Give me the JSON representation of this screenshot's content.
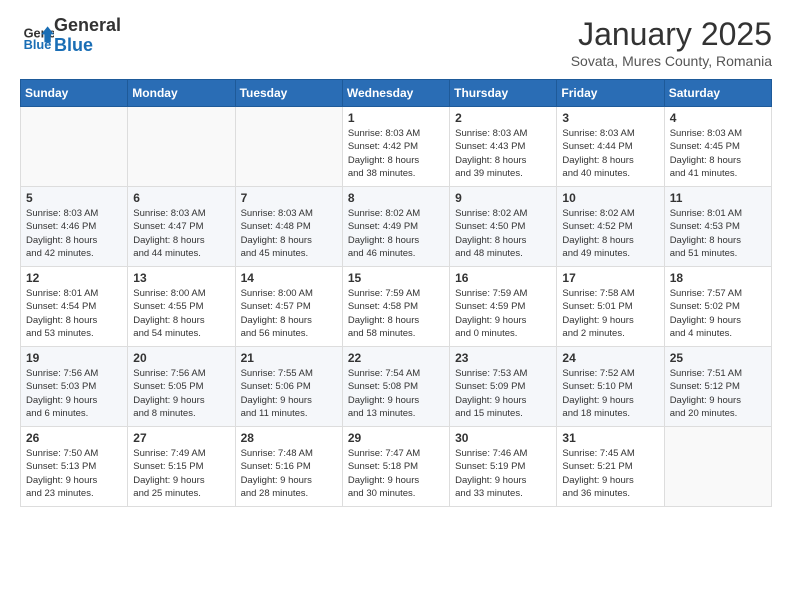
{
  "header": {
    "logo_general": "General",
    "logo_blue": "Blue",
    "month_title": "January 2025",
    "location": "Sovata, Mures County, Romania"
  },
  "days_of_week": [
    "Sunday",
    "Monday",
    "Tuesday",
    "Wednesday",
    "Thursday",
    "Friday",
    "Saturday"
  ],
  "weeks": [
    [
      {
        "day": "",
        "info": ""
      },
      {
        "day": "",
        "info": ""
      },
      {
        "day": "",
        "info": ""
      },
      {
        "day": "1",
        "info": "Sunrise: 8:03 AM\nSunset: 4:42 PM\nDaylight: 8 hours\nand 38 minutes."
      },
      {
        "day": "2",
        "info": "Sunrise: 8:03 AM\nSunset: 4:43 PM\nDaylight: 8 hours\nand 39 minutes."
      },
      {
        "day": "3",
        "info": "Sunrise: 8:03 AM\nSunset: 4:44 PM\nDaylight: 8 hours\nand 40 minutes."
      },
      {
        "day": "4",
        "info": "Sunrise: 8:03 AM\nSunset: 4:45 PM\nDaylight: 8 hours\nand 41 minutes."
      }
    ],
    [
      {
        "day": "5",
        "info": "Sunrise: 8:03 AM\nSunset: 4:46 PM\nDaylight: 8 hours\nand 42 minutes."
      },
      {
        "day": "6",
        "info": "Sunrise: 8:03 AM\nSunset: 4:47 PM\nDaylight: 8 hours\nand 44 minutes."
      },
      {
        "day": "7",
        "info": "Sunrise: 8:03 AM\nSunset: 4:48 PM\nDaylight: 8 hours\nand 45 minutes."
      },
      {
        "day": "8",
        "info": "Sunrise: 8:02 AM\nSunset: 4:49 PM\nDaylight: 8 hours\nand 46 minutes."
      },
      {
        "day": "9",
        "info": "Sunrise: 8:02 AM\nSunset: 4:50 PM\nDaylight: 8 hours\nand 48 minutes."
      },
      {
        "day": "10",
        "info": "Sunrise: 8:02 AM\nSunset: 4:52 PM\nDaylight: 8 hours\nand 49 minutes."
      },
      {
        "day": "11",
        "info": "Sunrise: 8:01 AM\nSunset: 4:53 PM\nDaylight: 8 hours\nand 51 minutes."
      }
    ],
    [
      {
        "day": "12",
        "info": "Sunrise: 8:01 AM\nSunset: 4:54 PM\nDaylight: 8 hours\nand 53 minutes."
      },
      {
        "day": "13",
        "info": "Sunrise: 8:00 AM\nSunset: 4:55 PM\nDaylight: 8 hours\nand 54 minutes."
      },
      {
        "day": "14",
        "info": "Sunrise: 8:00 AM\nSunset: 4:57 PM\nDaylight: 8 hours\nand 56 minutes."
      },
      {
        "day": "15",
        "info": "Sunrise: 7:59 AM\nSunset: 4:58 PM\nDaylight: 8 hours\nand 58 minutes."
      },
      {
        "day": "16",
        "info": "Sunrise: 7:59 AM\nSunset: 4:59 PM\nDaylight: 9 hours\nand 0 minutes."
      },
      {
        "day": "17",
        "info": "Sunrise: 7:58 AM\nSunset: 5:01 PM\nDaylight: 9 hours\nand 2 minutes."
      },
      {
        "day": "18",
        "info": "Sunrise: 7:57 AM\nSunset: 5:02 PM\nDaylight: 9 hours\nand 4 minutes."
      }
    ],
    [
      {
        "day": "19",
        "info": "Sunrise: 7:56 AM\nSunset: 5:03 PM\nDaylight: 9 hours\nand 6 minutes."
      },
      {
        "day": "20",
        "info": "Sunrise: 7:56 AM\nSunset: 5:05 PM\nDaylight: 9 hours\nand 8 minutes."
      },
      {
        "day": "21",
        "info": "Sunrise: 7:55 AM\nSunset: 5:06 PM\nDaylight: 9 hours\nand 11 minutes."
      },
      {
        "day": "22",
        "info": "Sunrise: 7:54 AM\nSunset: 5:08 PM\nDaylight: 9 hours\nand 13 minutes."
      },
      {
        "day": "23",
        "info": "Sunrise: 7:53 AM\nSunset: 5:09 PM\nDaylight: 9 hours\nand 15 minutes."
      },
      {
        "day": "24",
        "info": "Sunrise: 7:52 AM\nSunset: 5:10 PM\nDaylight: 9 hours\nand 18 minutes."
      },
      {
        "day": "25",
        "info": "Sunrise: 7:51 AM\nSunset: 5:12 PM\nDaylight: 9 hours\nand 20 minutes."
      }
    ],
    [
      {
        "day": "26",
        "info": "Sunrise: 7:50 AM\nSunset: 5:13 PM\nDaylight: 9 hours\nand 23 minutes."
      },
      {
        "day": "27",
        "info": "Sunrise: 7:49 AM\nSunset: 5:15 PM\nDaylight: 9 hours\nand 25 minutes."
      },
      {
        "day": "28",
        "info": "Sunrise: 7:48 AM\nSunset: 5:16 PM\nDaylight: 9 hours\nand 28 minutes."
      },
      {
        "day": "29",
        "info": "Sunrise: 7:47 AM\nSunset: 5:18 PM\nDaylight: 9 hours\nand 30 minutes."
      },
      {
        "day": "30",
        "info": "Sunrise: 7:46 AM\nSunset: 5:19 PM\nDaylight: 9 hours\nand 33 minutes."
      },
      {
        "day": "31",
        "info": "Sunrise: 7:45 AM\nSunset: 5:21 PM\nDaylight: 9 hours\nand 36 minutes."
      },
      {
        "day": "",
        "info": ""
      }
    ]
  ]
}
